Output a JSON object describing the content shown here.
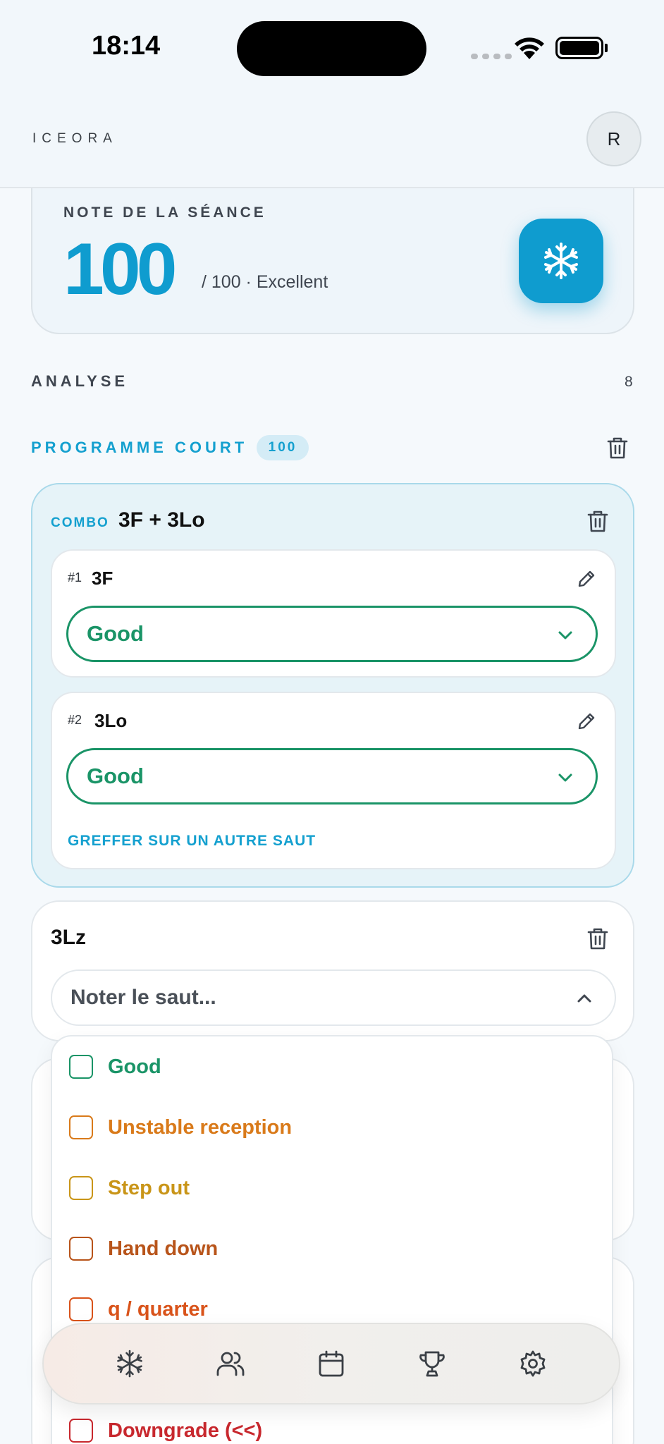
{
  "status": {
    "time": "18:14"
  },
  "header": {
    "logo": "ICEORA",
    "avatar_initial": "R"
  },
  "score": {
    "label": "NOTE DE LA SÉANCE",
    "value": "100",
    "subtitle": "/ 100 · Excellent"
  },
  "analysis": {
    "title": "ANALYSE",
    "count": "8"
  },
  "program": {
    "title": "PROGRAMME COURT",
    "badge": "100",
    "combo": {
      "tag": "COMBO",
      "name": "3F + 3Lo",
      "jumps": [
        {
          "num": "#1",
          "name": "3F",
          "grade": "Good"
        },
        {
          "num": "#2",
          "name": "3Lo",
          "grade": "Good"
        }
      ],
      "graft_label": "GREFFER SUR UN AUTRE SAUT"
    },
    "jump": {
      "name": "3Lz",
      "placeholder": "Noter le saut..."
    }
  },
  "grade_options": [
    {
      "label": "Good",
      "color": "#1a9467"
    },
    {
      "label": "Unstable reception",
      "color": "#d97a1a"
    },
    {
      "label": "Step out",
      "color": "#c99518"
    },
    {
      "label": "Hand down",
      "color": "#b8541a"
    },
    {
      "label": "q / quarter",
      "color": "#d9531a"
    },
    {
      "label": "Downgrade (<<)",
      "color": "#c8282e"
    }
  ],
  "nav": [
    "snowflake-icon",
    "users-icon",
    "calendar-icon",
    "trophy-icon",
    "settings-icon"
  ],
  "colors": {
    "accent": "#0f9ccf",
    "good": "#1a9467"
  }
}
